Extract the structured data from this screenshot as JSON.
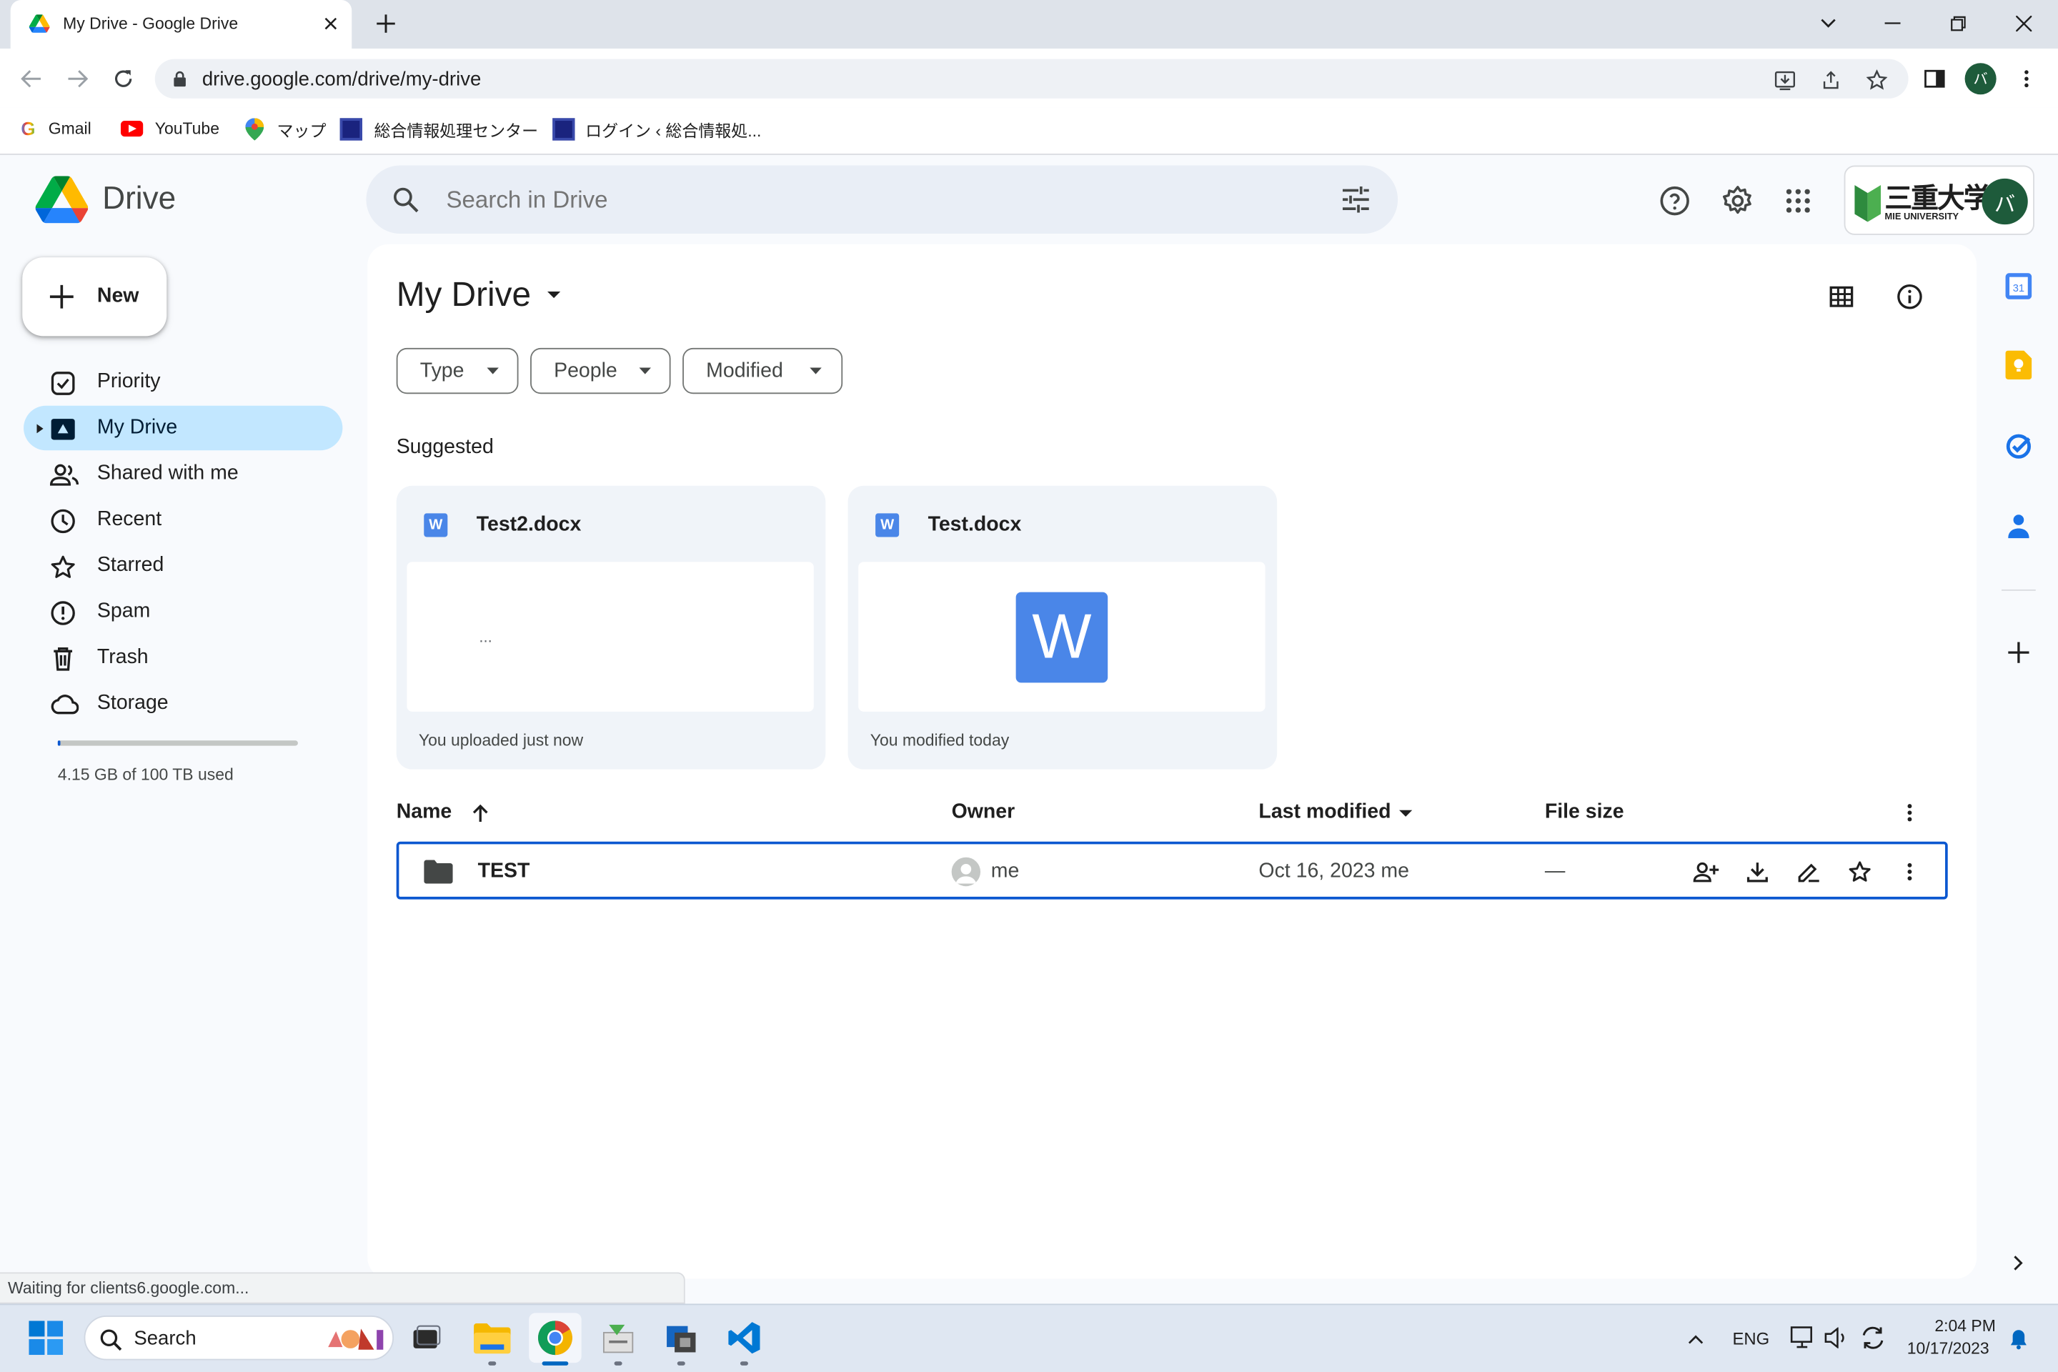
{
  "browser": {
    "tab_title": "My Drive - Google Drive",
    "url": "drive.google.com/drive/my-drive",
    "bookmarks": [
      {
        "label": "Gmail",
        "icon": "google-icon"
      },
      {
        "label": "YouTube",
        "icon": "youtube-icon"
      },
      {
        "label": "マップ",
        "icon": "maps-icon"
      },
      {
        "label": "総合情報処理センター",
        "icon": "site-icon"
      },
      {
        "label": "ログイン ‹ 総合情報処...",
        "icon": "site-icon"
      }
    ],
    "status_text": "Waiting for clients6.google.com..."
  },
  "drive": {
    "logo_text": "Drive",
    "search_placeholder": "Search in Drive",
    "new_label": "New",
    "account_initial": "バ",
    "org_logo_text": "三重大学",
    "org_logo_sub": "MIE UNIVERSITY",
    "nav": [
      {
        "label": "Priority",
        "icon": "priority-icon"
      },
      {
        "label": "My Drive",
        "icon": "my-drive-icon",
        "selected": true
      },
      {
        "label": "Shared with me",
        "icon": "shared-icon"
      },
      {
        "label": "Recent",
        "icon": "clock-icon"
      },
      {
        "label": "Starred",
        "icon": "star-icon"
      },
      {
        "label": "Spam",
        "icon": "spam-icon"
      },
      {
        "label": "Trash",
        "icon": "trash-icon"
      },
      {
        "label": "Storage",
        "icon": "cloud-icon"
      }
    ],
    "storage_text": "4.15 GB of 100 TB used",
    "storage_fraction": 4.15e-05,
    "page_title": "My Drive",
    "filters": [
      "Type",
      "People",
      "Modified"
    ],
    "suggested_label": "Suggested",
    "suggested": [
      {
        "name": "Test2.docx",
        "subtitle": "You uploaded just now",
        "preview": "..."
      },
      {
        "name": "Test.docx",
        "subtitle": "You modified today",
        "preview": "W"
      }
    ],
    "columns": {
      "name": "Name",
      "owner": "Owner",
      "modified": "Last modified",
      "size": "File size"
    },
    "rows": [
      {
        "name": "TEST",
        "owner": "me",
        "modified": "Oct 16, 2023 me",
        "size": "—"
      }
    ]
  },
  "taskbar": {
    "search_label": "Search",
    "lang": "ENG",
    "time": "2:04 PM",
    "date": "10/17/2023"
  },
  "colors": {
    "accent": "#0b57d0",
    "selected_nav": "#c2e7ff",
    "search_bg": "#e9eef6"
  }
}
